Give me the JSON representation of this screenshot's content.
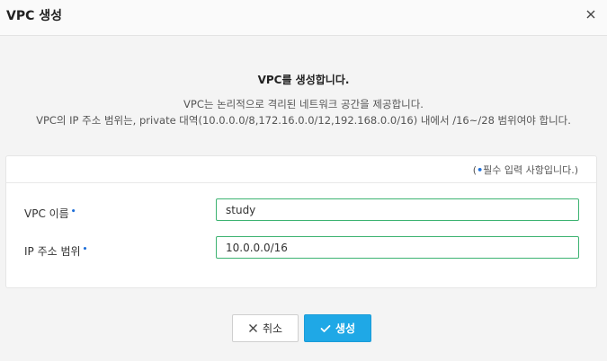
{
  "dialog": {
    "title": "VPC 생성"
  },
  "intro": {
    "title": "VPC를 생성합니다.",
    "desc_line1": "VPC는 논리적으로 격리된 네트워크 공간을 제공합니다.",
    "desc_line2": "VPC의 IP 주소 범위는, private 대역(10.0.0.0/8,172.16.0.0/12,192.168.0.0/16) 내에서 /16~/28 범위여야 합니다."
  },
  "form": {
    "required_note_prefix": "(",
    "required_note_dot": "•",
    "required_note_text": "필수 입력 사항입니다.)",
    "fields": [
      {
        "label": "VPC 이름",
        "required_mark": "•",
        "value": "study"
      },
      {
        "label": "IP 주소 범위",
        "required_mark": "•",
        "value": "10.0.0.0/16"
      }
    ]
  },
  "buttons": {
    "cancel_label": "취소",
    "create_label": "생성"
  },
  "colors": {
    "accent": "#1fa8e6",
    "input_border": "#3cb371",
    "required_dot": "#1e6fd9"
  },
  "icons": {
    "close": "close-icon",
    "cancel": "x-icon",
    "create": "check-icon"
  }
}
